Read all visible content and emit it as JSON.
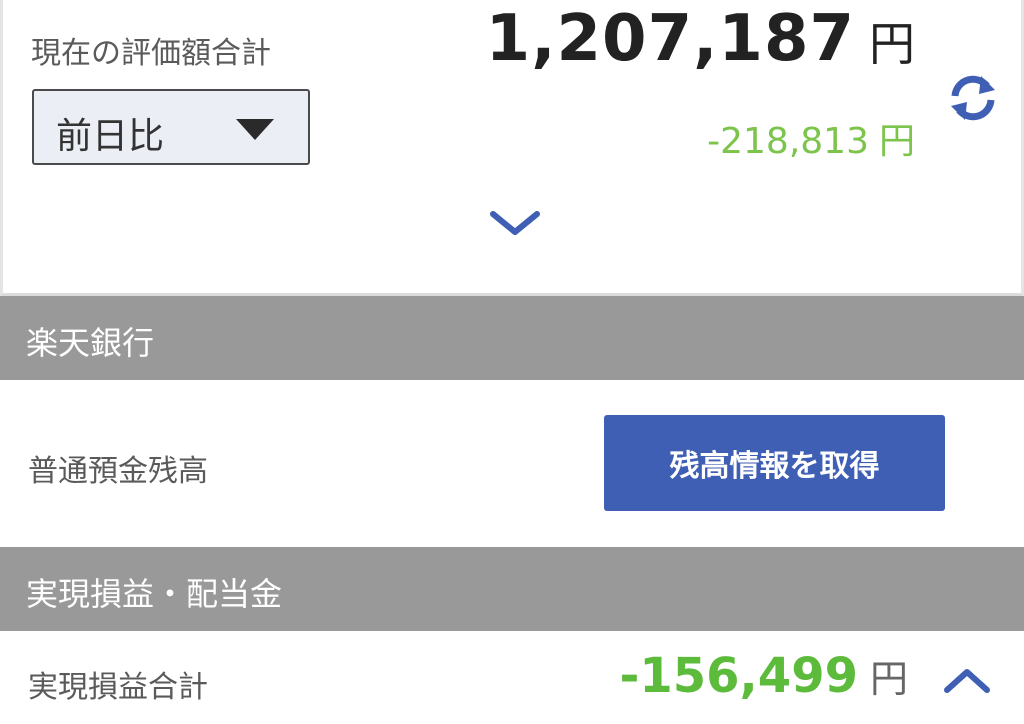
{
  "summary": {
    "total_label": "現在の評価額合計",
    "total_value": "1,207,187",
    "currency": "円",
    "period_select_value": "前日比",
    "change_value": "-218,813",
    "change_currency": "円"
  },
  "icons": {
    "refresh": "refresh-icon",
    "expand": "chevron-down-icon",
    "dropdown": "caret-down-icon",
    "collapse": "chevron-up-icon"
  },
  "colors": {
    "accent_blue": "#3f5fb4",
    "gain_loss_green": "#7cc44c",
    "section_header_gray": "#999999"
  },
  "bank_section": {
    "header": "楽天銀行",
    "balance_label": "普通預金残高",
    "fetch_button": "残高情報を取得"
  },
  "pl_section": {
    "header": "実現損益・配当金",
    "total_label": "実現損益合計",
    "total_value": "-156,499",
    "currency": "円"
  }
}
